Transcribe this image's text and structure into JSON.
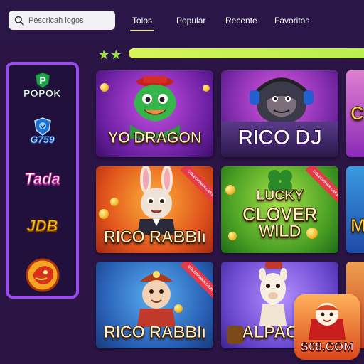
{
  "search": {
    "placeholder": "Pescricah logos"
  },
  "tabs": [
    {
      "label": "Tolos",
      "active": true
    },
    {
      "label": "Popular",
      "active": false
    },
    {
      "label": "Recente",
      "active": false
    },
    {
      "label": "Favoritos",
      "active": false
    }
  ],
  "rating": {
    "stars_filled": 2,
    "progress": 1.0
  },
  "sidebar": {
    "providers": [
      {
        "name": "POPOK",
        "badge": "P"
      },
      {
        "name": "G759"
      },
      {
        "name": "Tada"
      },
      {
        "name": "JDB"
      },
      {
        "name": "dragon-logo"
      }
    ]
  },
  "games": [
    {
      "title": "YO DRAGON",
      "ribbon": ""
    },
    {
      "title": "RICO DJ",
      "ribbon": ""
    },
    {
      "title": "RICO RABBIı",
      "ribbon": "COLECIONAR CARTA"
    },
    {
      "title_line1": "LUCKY",
      "title_line2": "CLOVER",
      "title_line3": "WILD",
      "ribbon": "COLECIONAR CARTA"
    },
    {
      "title": "RICO RABBIı",
      "ribbon": "COLECIONAR CARTA"
    },
    {
      "title": "ALPACA I",
      "ribbon": ""
    }
  ],
  "partial_cards": [
    {
      "text": "C"
    },
    {
      "text": "M"
    }
  ],
  "watermark": {
    "text": "S08.COM"
  },
  "colors": {
    "accent": "#9b4cf0",
    "progress": "#c8f25a",
    "star": "#9be03b",
    "background": "#2a1545"
  }
}
